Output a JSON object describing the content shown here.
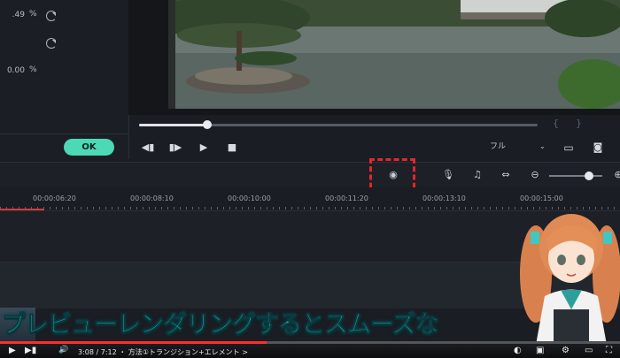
{
  "properties": {
    "rows": [
      {
        "value": ".49",
        "unit": "%"
      },
      {
        "value": "",
        "unit": ""
      },
      {
        "value": "0.00",
        "unit": "%"
      }
    ],
    "ok_label": "OK"
  },
  "preview": {
    "progress_percent": 17,
    "quality_label": "フル"
  },
  "timeline": {
    "ticks": [
      "00:00:06:20",
      "00:00:08:10",
      "00:00:10:00",
      "00:00:11:20",
      "00:00:13:10",
      "00:00:15:00"
    ]
  },
  "overlay": {
    "subtitle": "プレビューレンダリングするとスムーズな"
  },
  "player": {
    "time_text": "3:08 / 7:12 ・ 方法①トランジション+エレメント >",
    "progress_percent": 43,
    "accent_color": "#ff2d2d"
  }
}
